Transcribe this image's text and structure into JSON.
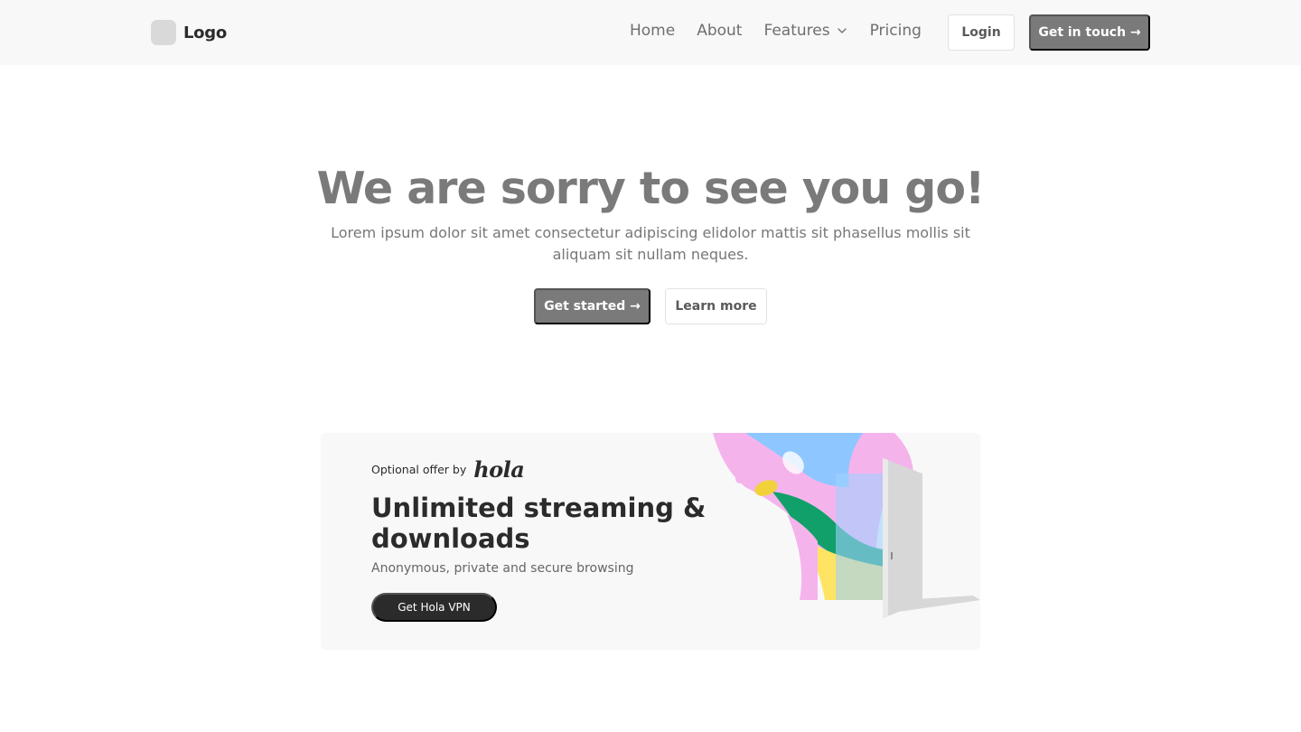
{
  "nav": {
    "logo_text": "Logo",
    "links": [
      {
        "label": "Home"
      },
      {
        "label": "About"
      },
      {
        "label": "Features"
      },
      {
        "label": "Pricing"
      }
    ],
    "login_label": "Login",
    "contact_label": "Get in touch →"
  },
  "hero": {
    "title": "We are sorry to see you go!",
    "subtitle": "Lorem ipsum dolor sit amet consectetur adipiscing elidolor mattis sit phasellus mollis sit aliquam sit nullam neques.",
    "primary_label": "Get started →",
    "secondary_label": "Learn more"
  },
  "ad": {
    "offer_prefix": "Optional offer by",
    "brand": "hola",
    "headline": "Unlimited streaming & downloads",
    "subtext": "Anonymous, private and secure browsing",
    "cta_label": "Get Hola VPN"
  },
  "colors": {
    "primary_button": "#7a7a7a",
    "ad_button": "#2b2b2b",
    "navbar_bg": "#f8f8f8"
  },
  "icons": {
    "features_dropdown": "chevron-down-icon"
  }
}
